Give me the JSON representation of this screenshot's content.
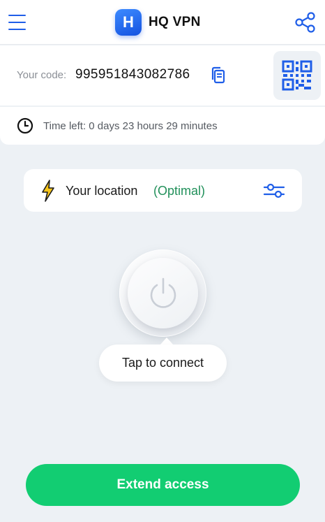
{
  "header": {
    "logo_letter": "H",
    "app_name": "HQ VPN"
  },
  "code_section": {
    "label": "Your code:",
    "value": "995951843082786"
  },
  "time_section": {
    "text": "Time left: 0 days 23 hours 29 minutes"
  },
  "location": {
    "label": "Your location",
    "status": "(Optimal)"
  },
  "connect": {
    "tooltip": "Tap to connect"
  },
  "footer": {
    "extend_label": "Extend access"
  },
  "colors": {
    "accent": "#1f5ee8",
    "success": "#12cd72",
    "optimal_text": "#21905a",
    "background": "#edf1f5"
  },
  "icons": [
    "menu-icon",
    "share-icon",
    "copy-icon",
    "qr-code-icon",
    "clock-icon",
    "lightning-bolt-icon",
    "filter-sliders-icon",
    "power-icon"
  ]
}
